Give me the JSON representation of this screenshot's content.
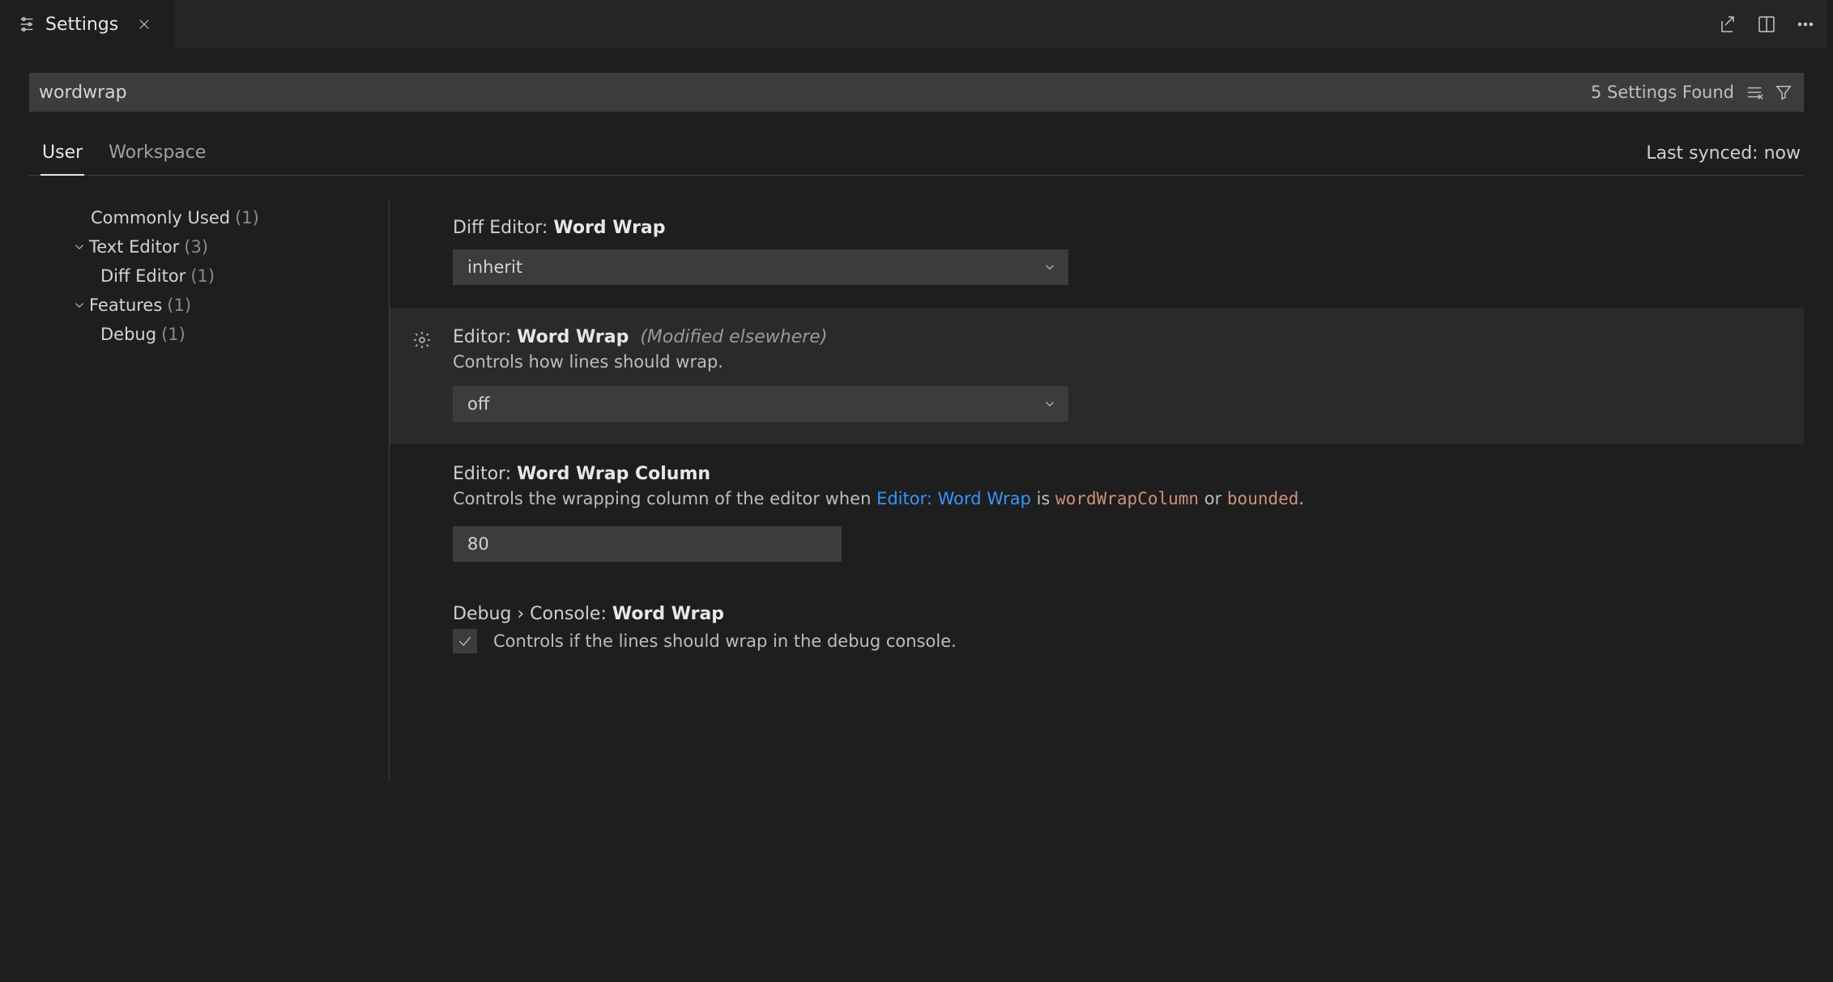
{
  "tab": {
    "title": "Settings"
  },
  "search": {
    "value": "wordwrap",
    "found_text": "5 Settings Found"
  },
  "scope": {
    "tabs": {
      "user": "User",
      "workspace": "Workspace"
    },
    "sync_status": "Last synced: now"
  },
  "toc": {
    "commonly_used": {
      "label": "Commonly Used",
      "count": "(1)"
    },
    "text_editor": {
      "label": "Text Editor",
      "count": "(3)"
    },
    "diff_editor": {
      "label": "Diff Editor",
      "count": "(1)"
    },
    "features": {
      "label": "Features",
      "count": "(1)"
    },
    "debug": {
      "label": "Debug",
      "count": "(1)"
    }
  },
  "settings": {
    "diff_word_wrap": {
      "prefix": "Diff Editor: ",
      "name": "Word Wrap",
      "value": "inherit"
    },
    "editor_word_wrap": {
      "prefix": "Editor: ",
      "name": "Word Wrap",
      "note": "(Modified elsewhere)",
      "desc": "Controls how lines should wrap.",
      "value": "off"
    },
    "editor_word_wrap_column": {
      "prefix": "Editor: ",
      "name": "Word Wrap Column",
      "desc_a": "Controls the wrapping column of the editor when ",
      "desc_link": "Editor: Word Wrap",
      "desc_b": " is ",
      "desc_code1": "wordWrapColumn",
      "desc_c": " or ",
      "desc_code2": "bounded",
      "desc_d": ".",
      "value": "80"
    },
    "debug_console_word_wrap": {
      "prefix": "Debug › Console: ",
      "name": "Word Wrap",
      "desc": "Controls if the lines should wrap in the debug console."
    }
  }
}
